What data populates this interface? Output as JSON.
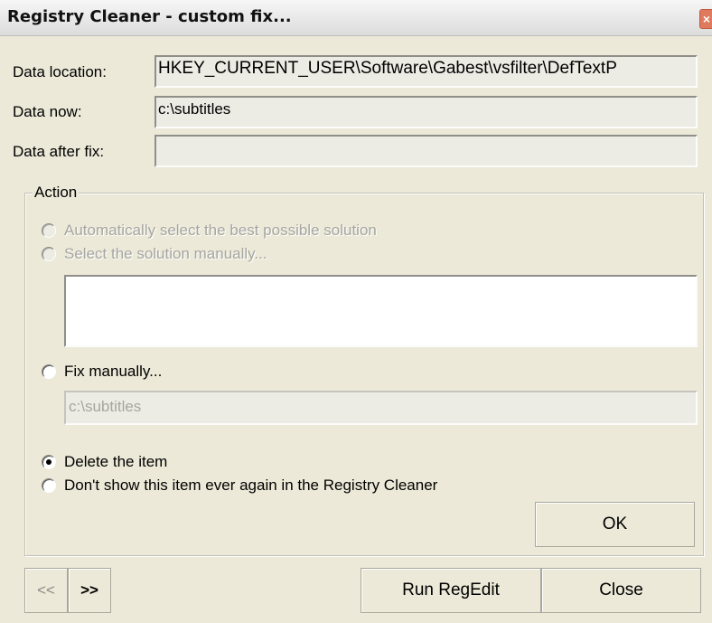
{
  "window": {
    "title": "Registry Cleaner - custom fix...",
    "close_glyph": "×"
  },
  "fields": {
    "data_location_label": "Data location:",
    "data_location_value": "HKEY_CURRENT_USER\\Software\\Gabest\\vsfilter\\DefTextP",
    "data_now_label": "Data now:",
    "data_now_value": "c:\\subtitles",
    "data_after_label": "Data after fix:",
    "data_after_value": ""
  },
  "action": {
    "legend": "Action",
    "options": [
      {
        "label": "Automatically select the best possible solution",
        "checked": false,
        "enabled": false
      },
      {
        "label": "Select the solution manually...",
        "checked": false,
        "enabled": false
      },
      {
        "label": "Fix manually...",
        "checked": false,
        "enabled": true
      },
      {
        "label": "Delete the item",
        "checked": true,
        "enabled": true
      },
      {
        "label": "Don't show this item ever again in the Registry Cleaner",
        "checked": false,
        "enabled": true
      }
    ],
    "manual_fix_value": "c:\\subtitles",
    "ok_label": "OK"
  },
  "footer": {
    "prev_label": "<<",
    "next_label": ">>",
    "run_regedit_label": "Run RegEdit",
    "close_label": "Close"
  },
  "icons": {
    "close": "close-icon"
  }
}
